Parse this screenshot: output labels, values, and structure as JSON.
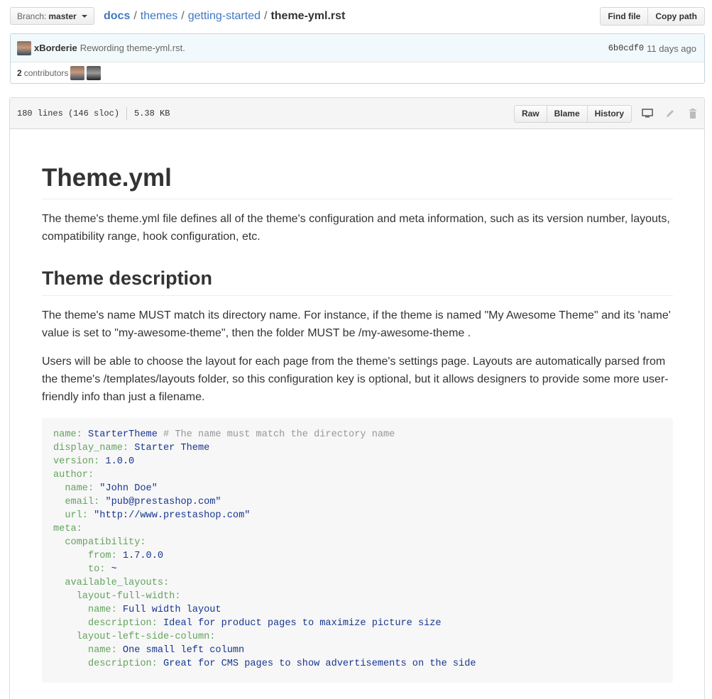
{
  "topbar": {
    "branch_label": "Branch:",
    "branch_value": "master",
    "breadcrumb": [
      {
        "label": "docs"
      },
      {
        "label": "themes"
      },
      {
        "label": "getting-started"
      }
    ],
    "separator": "/",
    "current_file": "theme-yml.rst",
    "find_file": "Find file",
    "copy_path": "Copy path"
  },
  "commit": {
    "author": "xBorderie",
    "message": "Rewording theme-yml.rst.",
    "sha": "6b0cdf0",
    "time": "11 days ago",
    "contributors_count": "2",
    "contributors_label": "contributors"
  },
  "file": {
    "lines": "180 lines (146 sloc)",
    "size": "5.38 KB",
    "raw": "Raw",
    "blame": "Blame",
    "history": "History",
    "icons": [
      "desktop-icon",
      "pencil-icon",
      "trash-icon"
    ]
  },
  "readme": {
    "h1": "Theme.yml",
    "p1": "The theme's theme.yml file defines all of the theme's configuration and meta information, such as its version number, layouts, compatibility range, hook configuration, etc.",
    "h2": "Theme description",
    "p2": "The theme's name MUST match its directory name. For instance, if the theme is named \"My Awesome Theme\" and its 'name' value is set to \"my-awesome-theme\", then the folder MUST be /my-awesome-theme .",
    "p3": "Users will be able to choose the layout for each page from the theme's settings page. Layouts are automatically parsed from the theme's /templates/layouts folder, so this configuration key is optional, but it allows designers to provide some more user-friendly info than just a filename.",
    "code": [
      {
        "indent": "",
        "key": "name:",
        "value": " StarterTheme",
        "comment": " # The name must match the directory name"
      },
      {
        "indent": "",
        "key": "display_name:",
        "value": " Starter Theme",
        "comment": ""
      },
      {
        "indent": "",
        "key": "version:",
        "value": " 1.0.0",
        "comment": ""
      },
      {
        "indent": "",
        "key": "author:",
        "value": "",
        "comment": ""
      },
      {
        "indent": "  ",
        "key": "name:",
        "value": " \"John Doe\"",
        "comment": ""
      },
      {
        "indent": "  ",
        "key": "email:",
        "value": " \"pub@prestashop.com\"",
        "comment": ""
      },
      {
        "indent": "  ",
        "key": "url:",
        "value": " \"http://www.prestashop.com\"",
        "comment": ""
      },
      {
        "indent": "",
        "key": "meta:",
        "value": "",
        "comment": ""
      },
      {
        "indent": "  ",
        "key": "compatibility:",
        "value": "",
        "comment": ""
      },
      {
        "indent": "      ",
        "key": "from:",
        "value": " 1.7.0.0",
        "comment": ""
      },
      {
        "indent": "      ",
        "key": "to:",
        "value": " ~",
        "comment": ""
      },
      {
        "indent": "  ",
        "key": "available_layouts:",
        "value": "",
        "comment": ""
      },
      {
        "indent": "    ",
        "key": "layout-full-width:",
        "value": "",
        "comment": ""
      },
      {
        "indent": "      ",
        "key": "name:",
        "value": " Full width layout",
        "comment": ""
      },
      {
        "indent": "      ",
        "key": "description:",
        "value": " Ideal for product pages to maximize picture size",
        "comment": ""
      },
      {
        "indent": "    ",
        "key": "layout-left-side-column:",
        "value": "",
        "comment": ""
      },
      {
        "indent": "      ",
        "key": "name:",
        "value": " One small left column",
        "comment": ""
      },
      {
        "indent": "      ",
        "key": "description:",
        "value": " Great for CMS pages to show advertisements on the side",
        "comment": ""
      }
    ]
  }
}
